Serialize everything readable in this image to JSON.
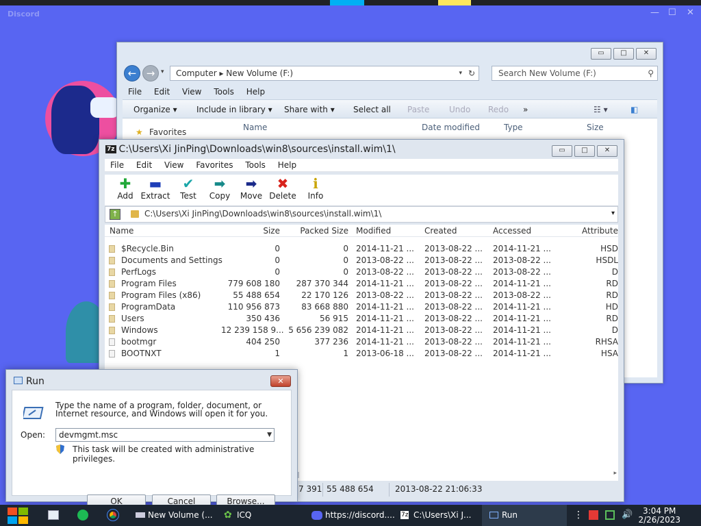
{
  "discord": {
    "brand": "Discord"
  },
  "explorer": {
    "address": "Computer ▸ New Volume (F:)",
    "search_placeholder": "Search New Volume (F:)",
    "menu": [
      "File",
      "Edit",
      "View",
      "Tools",
      "Help"
    ],
    "toolbar": {
      "organize": "Organize ▾",
      "include": "Include in library ▾",
      "share": "Share with ▾",
      "select_all": "Select all",
      "paste": "Paste",
      "undo": "Undo",
      "redo": "Redo",
      "more": "»"
    },
    "favorites": "Favorites",
    "columns": {
      "name": "Name",
      "modified": "Date modified",
      "type": "Type",
      "size": "Size"
    }
  },
  "sevenzip": {
    "title": "C:\\Users\\Xi JinPing\\Downloads\\win8\\sources\\install.wim\\1\\",
    "icon_label": "7z",
    "menu": [
      "File",
      "Edit",
      "View",
      "Favorites",
      "Tools",
      "Help"
    ],
    "toolbar": [
      {
        "label": "Add",
        "icon": "plus-icon",
        "glyph": "✚",
        "color": "#22a83a"
      },
      {
        "label": "Extract",
        "icon": "minus-icon",
        "glyph": "▬",
        "color": "#1f3fb8"
      },
      {
        "label": "Test",
        "icon": "check-icon",
        "glyph": "✔",
        "color": "#1aa6a8"
      },
      {
        "label": "Copy",
        "icon": "copy-arrow-icon",
        "glyph": "➡",
        "color": "#178a8a"
      },
      {
        "label": "Move",
        "icon": "move-arrow-icon",
        "glyph": "➡",
        "color": "#1a2a8a"
      },
      {
        "label": "Delete",
        "icon": "delete-x-icon",
        "glyph": "✖",
        "color": "#d8231c"
      },
      {
        "label": "Info",
        "icon": "info-icon",
        "glyph": "ℹ",
        "color": "#c9a400"
      }
    ],
    "path": "C:\\Users\\Xi JinPing\\Downloads\\win8\\sources\\install.wim\\1\\",
    "columns": {
      "name": "Name",
      "size": "Size",
      "packed": "Packed Size",
      "modified": "Modified",
      "created": "Created",
      "accessed": "Accessed",
      "attr": "Attribute"
    },
    "rows": [
      {
        "name": "$Recycle.Bin",
        "size": "0",
        "packed": "0",
        "modified": "2014-11-21 ...",
        "created": "2013-08-22 ...",
        "accessed": "2014-11-21 ...",
        "attr": "HSD",
        "folder": true
      },
      {
        "name": "Documents and Settings",
        "size": "0",
        "packed": "0",
        "modified": "2013-08-22 ...",
        "created": "2013-08-22 ...",
        "accessed": "2013-08-22 ...",
        "attr": "HSDL",
        "folder": true
      },
      {
        "name": "PerfLogs",
        "size": "0",
        "packed": "0",
        "modified": "2013-08-22 ...",
        "created": "2013-08-22 ...",
        "accessed": "2013-08-22 ...",
        "attr": "D",
        "folder": true
      },
      {
        "name": "Program Files",
        "size": "779 608 180",
        "packed": "287 370 344",
        "modified": "2014-11-21 ...",
        "created": "2013-08-22 ...",
        "accessed": "2014-11-21 ...",
        "attr": "RD",
        "folder": true
      },
      {
        "name": "Program Files (x86)",
        "size": "55 488 654",
        "packed": "22 170 126",
        "modified": "2013-08-22 ...",
        "created": "2013-08-22 ...",
        "accessed": "2013-08-22 ...",
        "attr": "RD",
        "folder": true
      },
      {
        "name": "ProgramData",
        "size": "110 956 873",
        "packed": "83 668 880",
        "modified": "2014-11-21 ...",
        "created": "2013-08-22 ...",
        "accessed": "2014-11-21 ...",
        "attr": "HD",
        "folder": true
      },
      {
        "name": "Users",
        "size": "350 436",
        "packed": "56 915",
        "modified": "2014-11-21 ...",
        "created": "2013-08-22 ...",
        "accessed": "2014-11-21 ...",
        "attr": "RD",
        "folder": true
      },
      {
        "name": "Windows",
        "size": "12 239 158 9...",
        "packed": "5 656 239 082",
        "modified": "2014-11-21 ...",
        "created": "2013-08-22 ...",
        "accessed": "2014-11-21 ...",
        "attr": "D",
        "folder": true
      },
      {
        "name": "bootmgr",
        "size": "404 250",
        "packed": "377 236",
        "modified": "2014-11-21 ...",
        "created": "2013-08-22 ...",
        "accessed": "2014-11-21 ...",
        "attr": "RHSA",
        "folder": false
      },
      {
        "name": "BOOTNXT",
        "size": "1",
        "packed": "1",
        "modified": "2013-06-18 ...",
        "created": "2013-08-22 ...",
        "accessed": "2014-11-21 ...",
        "attr": "HSA",
        "folder": false
      }
    ],
    "status": {
      "s1": "7 391",
      "s2": "55 488 654",
      "s3": "2013-08-22 21:06:33"
    }
  },
  "run": {
    "title": "Run",
    "description": "Type the name of a program, folder, document, or Internet resource, and Windows will open it for you.",
    "open_label": "Open:",
    "value": "devmgmt.msc",
    "admin_note": "This task will be created with administrative privileges.",
    "ok": "OK",
    "cancel": "Cancel",
    "browse": "Browse..."
  },
  "taskbar": {
    "tasks": [
      "New Volume (...",
      "ICQ",
      "https://discord....",
      "C:\\Users\\Xi J...",
      "Run"
    ],
    "time": "3:04 PM",
    "date": "2/26/2023"
  }
}
